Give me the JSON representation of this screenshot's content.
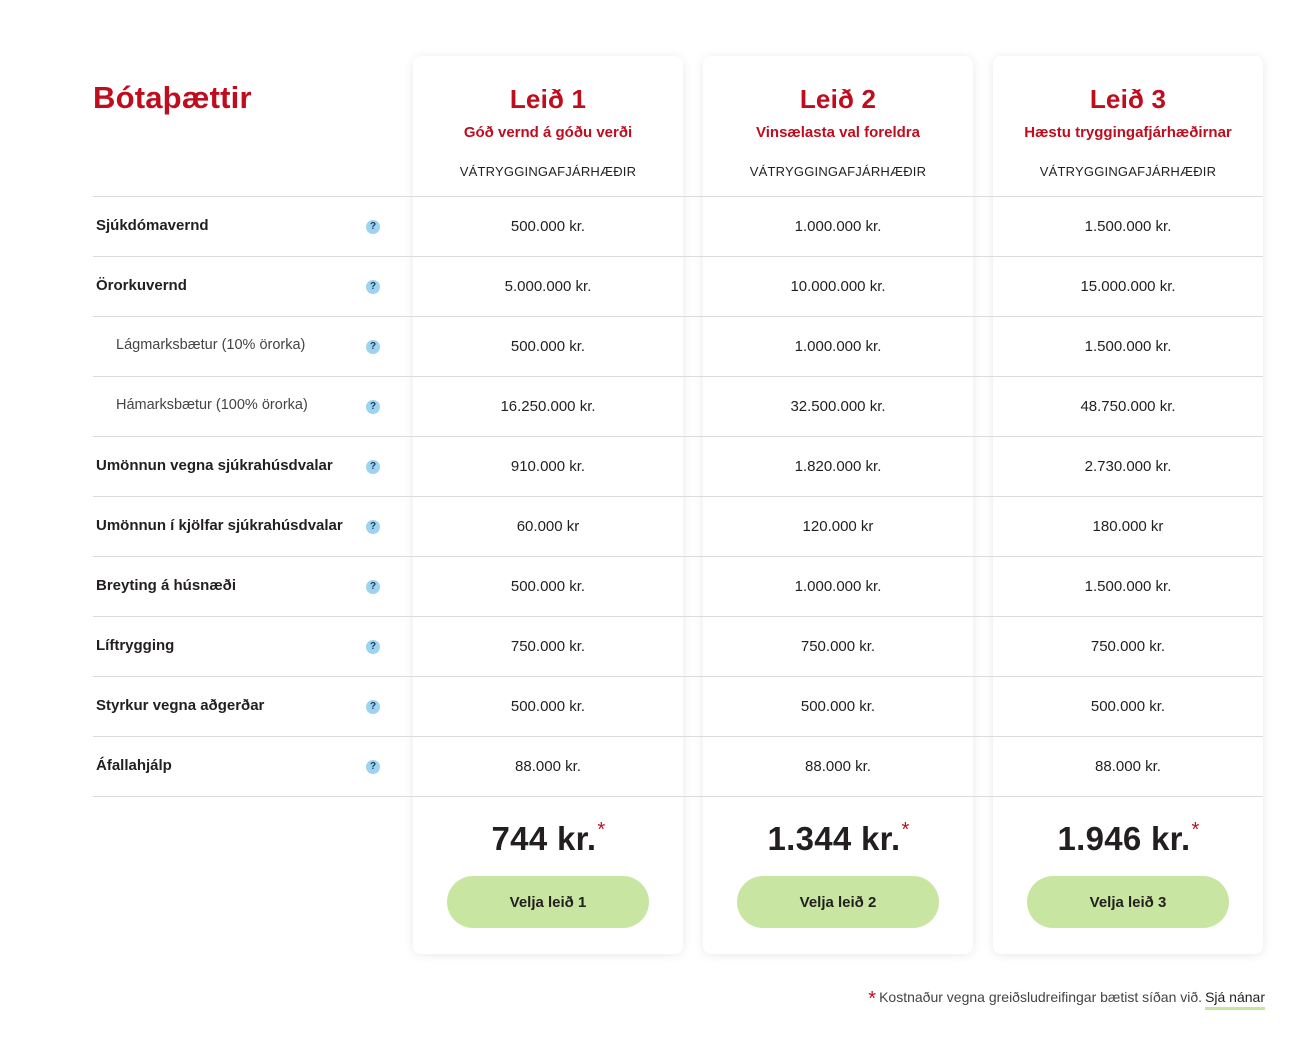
{
  "title": "Bótaþættir",
  "plans": [
    {
      "name": "Leið 1",
      "subtitle": "Góð vernd á góðu verði",
      "column_header": "VÁTRYGGINGAFJÁRHÆÐIR",
      "price": "744 kr.",
      "price_mark": "*",
      "button": "Velja leið 1"
    },
    {
      "name": "Leið 2",
      "subtitle": "Vinsælasta val foreldra",
      "column_header": "VÁTRYGGINGAFJÁRHÆÐIR",
      "price": "1.344 kr.",
      "price_mark": "*",
      "button": "Velja leið 2"
    },
    {
      "name": "Leið 3",
      "subtitle": "Hæstu tryggingafjárhæðirnar",
      "column_header": "VÁTRYGGINGAFJÁRHÆÐIR",
      "price": "1.946 kr.",
      "price_mark": "*",
      "button": "Velja leið 3"
    }
  ],
  "help_glyph": "?",
  "rows": [
    {
      "label": "Sjúkdómavernd",
      "values": [
        "500.000 kr.",
        "1.000.000 kr.",
        "1.500.000 kr."
      ]
    },
    {
      "label": "Örorkuvernd",
      "values": [
        "5.000.000 kr.",
        "10.000.000 kr.",
        "15.000.000 kr."
      ]
    },
    {
      "label": "Lágmarksbætur (10% örorka)",
      "values": [
        "500.000 kr.",
        "1.000.000 kr.",
        "1.500.000 kr."
      ]
    },
    {
      "label": "Hámarksbætur (100% örorka)",
      "values": [
        "16.250.000 kr.",
        "32.500.000 kr.",
        "48.750.000 kr."
      ]
    },
    {
      "label": "Umönnun vegna sjúkrahúsdvalar",
      "values": [
        "910.000 kr.",
        "1.820.000 kr.",
        "2.730.000 kr."
      ]
    },
    {
      "label": "Umönnun í kjölfar sjúkrahúsdvalar",
      "values": [
        "60.000 kr",
        "120.000 kr",
        "180.000 kr"
      ]
    },
    {
      "label": "Breyting á húsnæði",
      "values": [
        "500.000 kr.",
        "1.000.000 kr.",
        "1.500.000 kr."
      ]
    },
    {
      "label": "Líftrygging",
      "values": [
        "750.000 kr.",
        "750.000 kr.",
        "750.000 kr."
      ]
    },
    {
      "label": "Styrkur vegna aðgerðar",
      "values": [
        "500.000 kr.",
        "500.000 kr.",
        "500.000 kr."
      ]
    },
    {
      "label": "Áfallahjálp",
      "values": [
        "88.000 kr.",
        "88.000 kr.",
        "88.000 kr."
      ]
    }
  ],
  "footnote": {
    "mark": "*",
    "text": "Kostnaður vegna greiðsludreifingar bætist síðan við.",
    "link": "Sjá nánar"
  },
  "colors": {
    "brand_red": "#c00d1e",
    "button_green": "#c8e6a1",
    "help_blue": "#9ed3f0"
  }
}
